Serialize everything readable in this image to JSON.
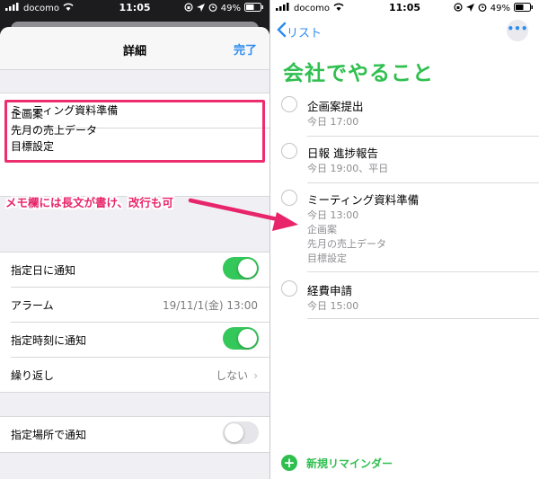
{
  "status_bar": {
    "carrier": "docomo",
    "time": "11:05",
    "battery": "49%"
  },
  "detail_sheet": {
    "title": "詳細",
    "done_label": "完了",
    "task_title": "ミーティング資料準備",
    "notes": [
      "企画案",
      "先月の売上データ",
      "目標設定"
    ],
    "annotation": "メモ欄には長文が書け、改行も可",
    "rows": [
      {
        "label": "指定日に通知",
        "toggle": "on"
      },
      {
        "label": "アラーム",
        "value": "19/11/1(金) 13:00"
      },
      {
        "label": "指定時刻に通知",
        "toggle": "on"
      },
      {
        "label": "繰り返し",
        "value": "しない"
      }
    ],
    "location_row": {
      "label": "指定場所で通知",
      "toggle": "off"
    }
  },
  "list_view": {
    "back_label": "リスト",
    "more_icon": "ellipsis-icon",
    "title": "会社でやること",
    "accent_color": "#2fbf4f",
    "items": [
      {
        "title": "企画案提出",
        "sub": [
          "今日 17:00"
        ]
      },
      {
        "title": "日報 進捗報告",
        "sub": [
          "今日 19:00、平日"
        ]
      },
      {
        "title": "ミーティング資料準備",
        "sub": [
          "今日 13:00",
          "企画案",
          "先月の売上データ",
          "目標設定"
        ]
      },
      {
        "title": "経費申請",
        "sub": [
          "今日 15:00"
        ]
      }
    ],
    "new_reminder_label": "新規リマインダー"
  },
  "colors": {
    "highlight": "#ec2e6f",
    "link_blue": "#2d8cf0",
    "toggle_on": "#34c759"
  }
}
